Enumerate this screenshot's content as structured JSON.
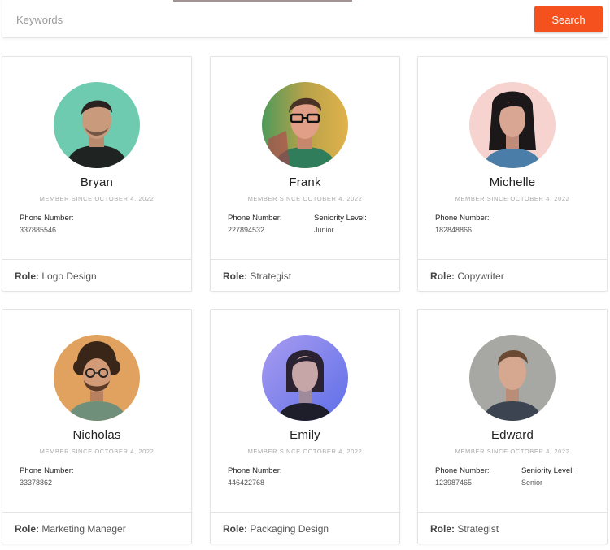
{
  "search": {
    "placeholder": "Keywords",
    "button_label": "Search",
    "button_color": "#f4511e"
  },
  "labels": {
    "phone": "Phone Number:",
    "seniority": "Seniority Level:",
    "role": "Role:"
  },
  "members": [
    {
      "name": "Bryan",
      "since": "MEMBER SINCE OCTOBER 4, 2022",
      "phone": "337885546",
      "seniority": null,
      "role": "Logo Design",
      "avatar_bg": "#6ecbb0"
    },
    {
      "name": "Frank",
      "since": "MEMBER SINCE OCTOBER 4, 2022",
      "phone": "227894532",
      "seniority": "Junior",
      "role": "Strategist",
      "avatar_bg": "#c9a24a"
    },
    {
      "name": "Michelle",
      "since": "MEMBER SINCE OCTOBER 4, 2022",
      "phone": "182848866",
      "seniority": null,
      "role": "Copywriter",
      "avatar_bg": "#f7d3cf"
    },
    {
      "name": "Nicholas",
      "since": "MEMBER SINCE OCTOBER 4, 2022",
      "phone": "33378862",
      "seniority": null,
      "role": "Marketing Manager",
      "avatar_bg": "#e0a25e"
    },
    {
      "name": "Emily",
      "since": "MEMBER SINCE OCTOBER 4, 2022",
      "phone": "446422768",
      "seniority": null,
      "role": "Packaging Design",
      "avatar_bg": "#8f92ef"
    },
    {
      "name": "Edward",
      "since": "MEMBER SINCE OCTOBER 4, 2022",
      "phone": "123987465",
      "seniority": "Senior",
      "role": "Strategist",
      "avatar_bg": "#a7a7a3"
    }
  ]
}
